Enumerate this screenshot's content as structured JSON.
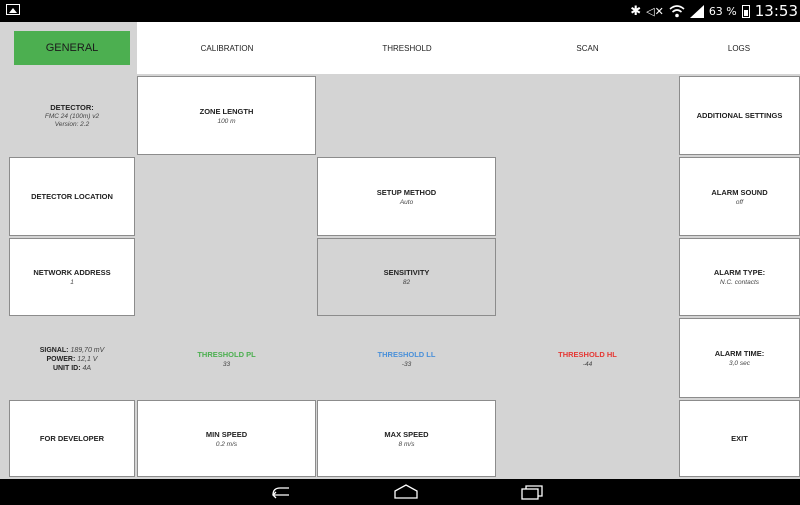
{
  "status_bar": {
    "battery_percent": "63 %",
    "time": "13:53",
    "icons": [
      "gallery-icon",
      "bluetooth-icon",
      "mute-icon",
      "wifi-icon",
      "signal-icon",
      "battery-icon"
    ]
  },
  "tabs": [
    {
      "label": "GENERAL",
      "active": true
    },
    {
      "label": "CALIBRATION",
      "active": false
    },
    {
      "label": "THRESHOLD",
      "active": false
    },
    {
      "label": "SCAN",
      "active": false
    },
    {
      "label": "LOGS",
      "active": false
    }
  ],
  "colors": {
    "active_tab": "#4caf50",
    "threshold_pl": "#4caf50",
    "threshold_ll": "#4a90d9",
    "threshold_hl": "#e53935"
  },
  "detector": {
    "title": "DETECTOR:",
    "model": "FMC 24 (100m) v2",
    "version": "Version: 2.2"
  },
  "zone_length": {
    "title": "ZONE LENGTH",
    "value": "100 m"
  },
  "additional_settings": {
    "title": "ADDITIONAL SETTINGS"
  },
  "detector_location": {
    "title": "DETECTOR LOCATION"
  },
  "setup_method": {
    "title": "SETUP METHOD",
    "value": "Auto"
  },
  "alarm_sound": {
    "title": "ALARM SOUND",
    "value": "off"
  },
  "network_address": {
    "title": "NETWORK ADDRESS",
    "value": "1"
  },
  "sensitivity": {
    "title": "SENSITIVITY",
    "value": "82"
  },
  "alarm_type": {
    "title": "ALARM TYPE:",
    "value": "N.C. contacts"
  },
  "status_info": {
    "signal_label": "SIGNAL:",
    "signal_value": "189,70 mV",
    "power_label": "POWER:",
    "power_value": "12,1 V",
    "unit_label": "UNIT ID:",
    "unit_value": "4A"
  },
  "threshold_pl": {
    "title": "THRESHOLD PL",
    "value": "33"
  },
  "threshold_ll": {
    "title": "THRESHOLD LL",
    "value": "-33"
  },
  "threshold_hl": {
    "title": "THRESHOLD HL",
    "value": "-44"
  },
  "alarm_time": {
    "title": "ALARM TIME:",
    "value": "3,0 sec"
  },
  "for_developer": {
    "title": "FOR DEVELOPER"
  },
  "min_speed": {
    "title": "MIN SPEED",
    "value": "0.2 m/s"
  },
  "max_speed": {
    "title": "MAX SPEED",
    "value": "8 m/s"
  },
  "exit": {
    "title": "EXIT"
  }
}
